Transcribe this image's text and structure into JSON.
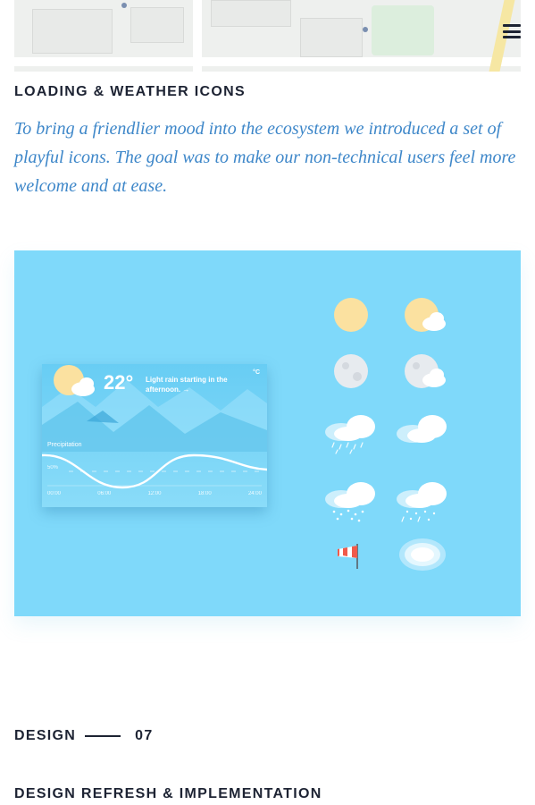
{
  "header": {
    "menu_icon": "hamburger-menu-icon",
    "map_preview": "map-preview"
  },
  "section": {
    "title": "LOADING & WEATHER ICONS",
    "body": "To bring a friendlier mood into the ecosystem we introduced a set of playful icons. The goal was to make our non-technical users feel more welcome and at ease."
  },
  "weather_card": {
    "temperature": "22°",
    "description": "Light rain starting in the afternoon. →",
    "unit": "°C",
    "precipitation_label": "Precipitation",
    "precipitation_level": "50%",
    "times": [
      "00:00",
      "06:00",
      "12:00",
      "18:00",
      "24:00"
    ]
  },
  "icon_set": [
    "sun-icon",
    "sun-cloud-icon",
    "moon-icon",
    "moon-cloud-icon",
    "rain-cloud-icon",
    "cloudy-icon",
    "snow-cloud-icon",
    "sleet-cloud-icon",
    "windsock-icon",
    "fog-icon"
  ],
  "colors": {
    "panel": "#7fd9fa",
    "accent_text": "#3e87c9",
    "heading": "#1d2333",
    "sun": "#fbe1a0"
  },
  "design": {
    "label": "DESIGN",
    "number": "07"
  },
  "next_section": {
    "title": "DESIGN REFRESH & IMPLEMENTATION"
  }
}
